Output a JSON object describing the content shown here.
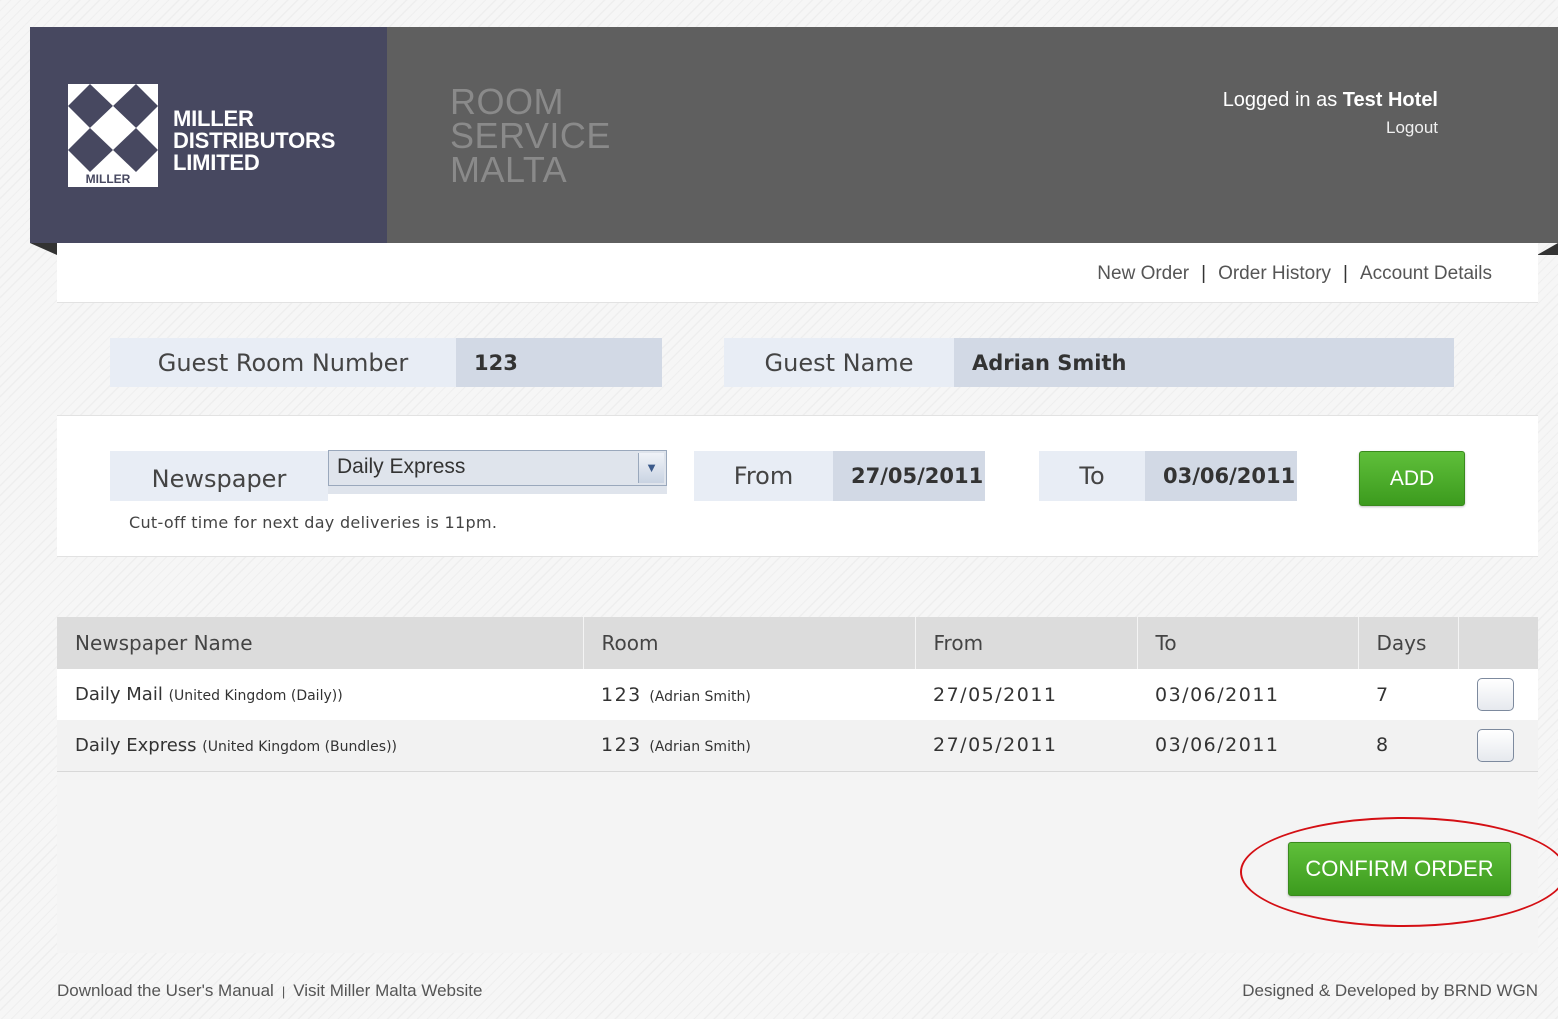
{
  "header": {
    "logo": {
      "line1": "MILLER",
      "line2": "DISTRIBUTORS",
      "line3": "LIMITED",
      "badge": "MILLER"
    },
    "app_title": {
      "line1": "ROOM",
      "line2": "SERVICE",
      "line3": "MALTA"
    },
    "user": {
      "prefix": "Logged in as",
      "name": "Test Hotel",
      "logout_label": "Logout"
    }
  },
  "nav": {
    "items": [
      "New Order",
      "Order History",
      "Account Details"
    ],
    "separator": "|"
  },
  "guest": {
    "room_label": "Guest Room Number",
    "room_value": "123",
    "name_label": "Guest Name",
    "name_value": "Adrian Smith"
  },
  "order_form": {
    "newspaper_label": "Newspaper",
    "newspaper_selected": "Daily Express",
    "from_label": "From",
    "from_value": "27/05/2011",
    "to_label": "To",
    "to_value": "03/06/2011",
    "add_label": "ADD",
    "cutoff_note": "Cut-off time for next day deliveries is 11pm."
  },
  "table": {
    "columns": [
      "Newspaper Name",
      "Room",
      "From",
      "To",
      "Days"
    ],
    "rows": [
      {
        "name": "Daily Mail",
        "edition": "(United Kingdom (Daily))",
        "room": "123",
        "guest": "(Adrian Smith)",
        "from": "27/05/2011",
        "to": "03/06/2011",
        "days": "7"
      },
      {
        "name": "Daily Express",
        "edition": "(United Kingdom (Bundles))",
        "room": "123",
        "guest": "(Adrian Smith)",
        "from": "27/05/2011",
        "to": "03/06/2011",
        "days": "8"
      }
    ]
  },
  "confirm_label": "CONFIRM ORDER",
  "footer": {
    "manual_link": "Download the User's Manual",
    "separator": "|",
    "website_link": "Visit Miller Malta Website",
    "credit": "Designed & Developed by BRND WGN"
  },
  "colors": {
    "header_dark": "#5f5f5f",
    "logo_panel": "#474860",
    "button_green": "#4caf2c",
    "annotation_red": "#d40f14"
  }
}
